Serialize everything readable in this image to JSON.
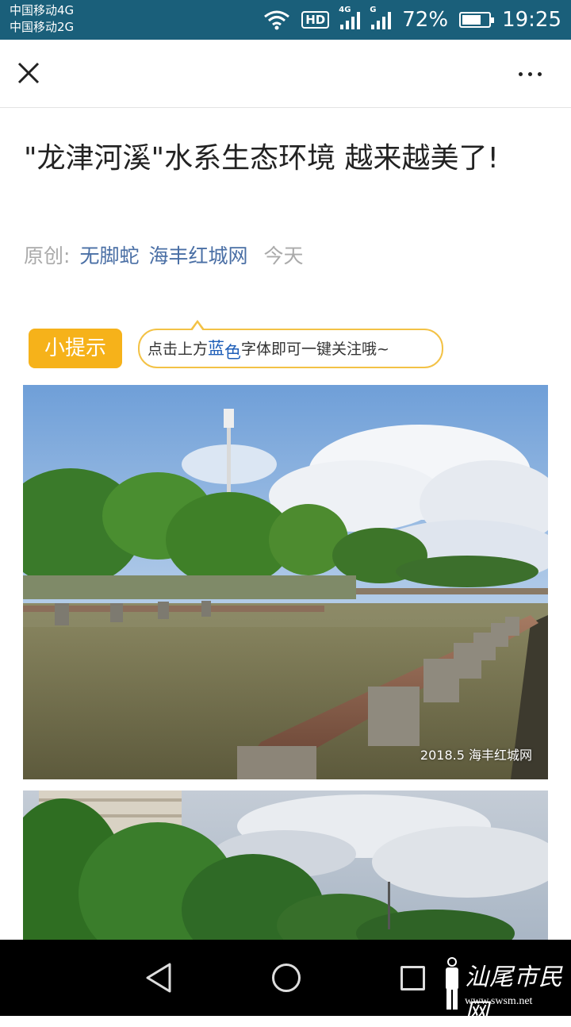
{
  "status_bar": {
    "carrier_1": "中国移动4G",
    "carrier_2": "中国移动2G",
    "hd_label": "HD",
    "signal_1_tag": "4G",
    "signal_2_tag": "G",
    "battery_percent": "72%",
    "battery_level": 0.72,
    "time": "19:25",
    "background_color": "#1a5f7a"
  },
  "nav": {
    "close_icon": "close-icon",
    "more_icon": "more-icon"
  },
  "article": {
    "title": "\"龙津河溪\"水系生态环境 越来越美了!",
    "meta_prefix": "原创:",
    "author": "无脚蛇",
    "account": "海丰红城网",
    "date": "今天"
  },
  "tip": {
    "badge": "小提示",
    "text_before": "点击上方",
    "text_blue_1": "蓝",
    "text_blue_2": "色",
    "text_after": "字体即可一键关注哦~",
    "badge_color": "#f6b21a"
  },
  "images": {
    "photo_1_watermark": "2018.5 海丰红城网"
  },
  "bottom_nav": {
    "back_icon": "back-icon",
    "home_icon": "home-icon",
    "recents_icon": "recents-icon"
  },
  "logo": {
    "text": "汕尾市民网",
    "url": "www.swsm.net"
  }
}
